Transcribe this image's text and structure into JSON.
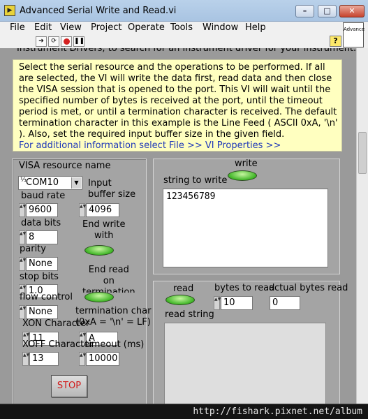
{
  "window": {
    "title": "Advanced Serial Write and Read.vi",
    "controls": {
      "minimize": "–",
      "maximize": "□",
      "close": "✕"
    }
  },
  "menu": [
    "File",
    "Edit",
    "View",
    "Project",
    "Operate",
    "Tools",
    "Window",
    "Help"
  ],
  "toolbar": {
    "buttons": [
      "run-arrow",
      "run-continuously",
      "abort",
      "pause"
    ],
    "help": "?",
    "vi_icon_text": "Advance"
  },
  "panel": {
    "cut_text": "Instrument Drivers, to search for an instrument driver for your instrument.",
    "description": "Select the serial resource and the operations to be performed.  If all are selected, the VI will write the data first, read data and then close the VISA session that is opened to the port.  This VI will wait until the specified number of bytes is received at the port, until the timeout period is met, or until a termination character is received.  The default termination character in this example is the Line Feed ( ASCII 0xA, '\\n' ).  Also, set the required input buffer size in the given field.",
    "info_link": "For additional information select File >> VI Properties >>"
  },
  "settings": {
    "visa_label": "VISA resource name",
    "visa_value": "COM10",
    "baud_label": "baud rate",
    "baud_value": "9600",
    "input_buffer_label": "Input\nbuffer size",
    "input_buffer_value": "4096",
    "data_bits_label": "data bits",
    "data_bits_value": "8",
    "end_write_label": "End write\nwith",
    "parity_label": "parity",
    "parity_value": "None",
    "end_read_label": "End read\non\ntermination",
    "stop_bits_label": "stop bits",
    "stop_bits_value": "1.0",
    "flow_label": "flow control",
    "flow_value": "None",
    "term_char_label": "termination char\n(0xA = '\\n' = LF)",
    "term_char_value": "A",
    "xon_label": "XON Character",
    "xon_value": "11",
    "xoff_label": "XOFF Character",
    "xoff_value": "13",
    "timeout_label": "timeout (ms)",
    "timeout_value": "10000"
  },
  "write": {
    "write_label": "write",
    "string_label": "string to write",
    "string_value": "123456789"
  },
  "read": {
    "read_label": "read",
    "bytes_label": "bytes to read",
    "bytes_value": "10",
    "actual_label": "actual bytes read",
    "actual_value": "0",
    "string_label": "read string"
  },
  "stop_label": "STOP",
  "watermark": "http://fishark.pixnet.net/album"
}
